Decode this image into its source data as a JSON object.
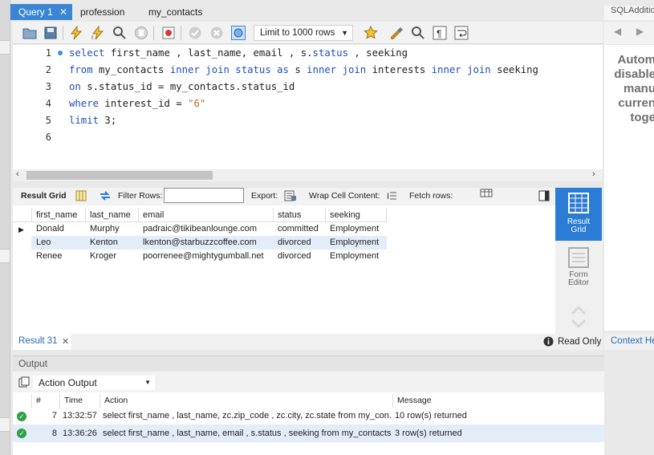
{
  "tabs": [
    {
      "label": "Query 1",
      "active": true
    },
    {
      "label": "profession",
      "active": false
    },
    {
      "label": "my_contacts",
      "active": false
    }
  ],
  "toolbar": {
    "limit_label": "Limit to 1000 rows",
    "icons": [
      "open-folder-icon",
      "save-icon",
      "execute-icon",
      "execute-current-icon",
      "explain-icon",
      "stop-icon",
      "toggle-error-icon",
      "commit-icon",
      "rollback-icon",
      "autocommit-icon",
      "beautify-icon",
      "brush-icon",
      "find-icon",
      "invisible-chars-icon",
      "wrap-icon"
    ]
  },
  "editor": {
    "lines": [
      {
        "n": "1",
        "tokens": [
          [
            "kw",
            "select"
          ],
          [
            "t",
            " first_name , last_name, email , s."
          ],
          [
            "kw",
            "status"
          ],
          [
            "t",
            " , seeking"
          ]
        ]
      },
      {
        "n": "2",
        "tokens": [
          [
            "kw",
            "from"
          ],
          [
            "t",
            " my_contacts "
          ],
          [
            "kw",
            "inner join status as"
          ],
          [
            "t",
            " s "
          ],
          [
            "kw",
            "inner join"
          ],
          [
            "t",
            " interests "
          ],
          [
            "kw",
            "inner join"
          ],
          [
            "t",
            " seeking"
          ]
        ]
      },
      {
        "n": "3",
        "tokens": [
          [
            "kw",
            "on"
          ],
          [
            "t",
            " s.status_id = my_contacts.status_id"
          ]
        ]
      },
      {
        "n": "4",
        "tokens": [
          [
            "kw",
            "where"
          ],
          [
            "t",
            " interest_id = "
          ],
          [
            "str",
            "\"6\""
          ]
        ]
      },
      {
        "n": "5",
        "tokens": [
          [
            "kw",
            "limit"
          ],
          [
            "t",
            " 3;"
          ]
        ]
      },
      {
        "n": "6",
        "tokens": []
      }
    ]
  },
  "result_toolbar": {
    "result_grid": "Result Grid",
    "filter_rows": "Filter Rows:",
    "export": "Export:",
    "wrap_cell": "Wrap Cell Content:",
    "fetch_rows": "Fetch rows:"
  },
  "grid": {
    "columns": [
      "first_name",
      "last_name",
      "email",
      "status",
      "seeking"
    ],
    "rows": [
      [
        "Donald",
        "Murphy",
        "padraic@tikibeanlounge.com",
        "committed",
        "Employment"
      ],
      [
        "Leo",
        "Kenton",
        "lkenton@starbuzzcoffee.com",
        "divorced",
        "Employment"
      ],
      [
        "Renee",
        "Kroger",
        "poorrenee@mightygumball.net",
        "divorced",
        "Employment"
      ]
    ]
  },
  "side_panel": {
    "result_grid": [
      "Result",
      "Grid"
    ],
    "form_editor": [
      "Form",
      "Editor"
    ]
  },
  "result_tab": {
    "label": "Result 31",
    "read_only": "Read Only"
  },
  "output": {
    "title": "Output",
    "select_label": "Action Output",
    "columns": [
      "#",
      "Time",
      "Action",
      "Message"
    ],
    "rows": [
      {
        "n": "7",
        "time": "13:32:57",
        "action": "select first_name , last_name, zc.zip_code , zc.city, zc.state from my_con...",
        "message": "10 row(s) returned"
      },
      {
        "n": "8",
        "time": "13:36:26",
        "action": "select first_name , last_name, email , s.status , seeking  from my_contacts...",
        "message": "3 row(s) returned"
      }
    ]
  },
  "right_panel": {
    "header": "SQLAdditions",
    "text_lines": [
      "Autom",
      "disable",
      "manu",
      "curren",
      "toge"
    ],
    "context_help": "Context Help"
  },
  "colors": {
    "accent": "#3b86d4",
    "keyword": "#1f4fb5",
    "string": "#c07020"
  }
}
